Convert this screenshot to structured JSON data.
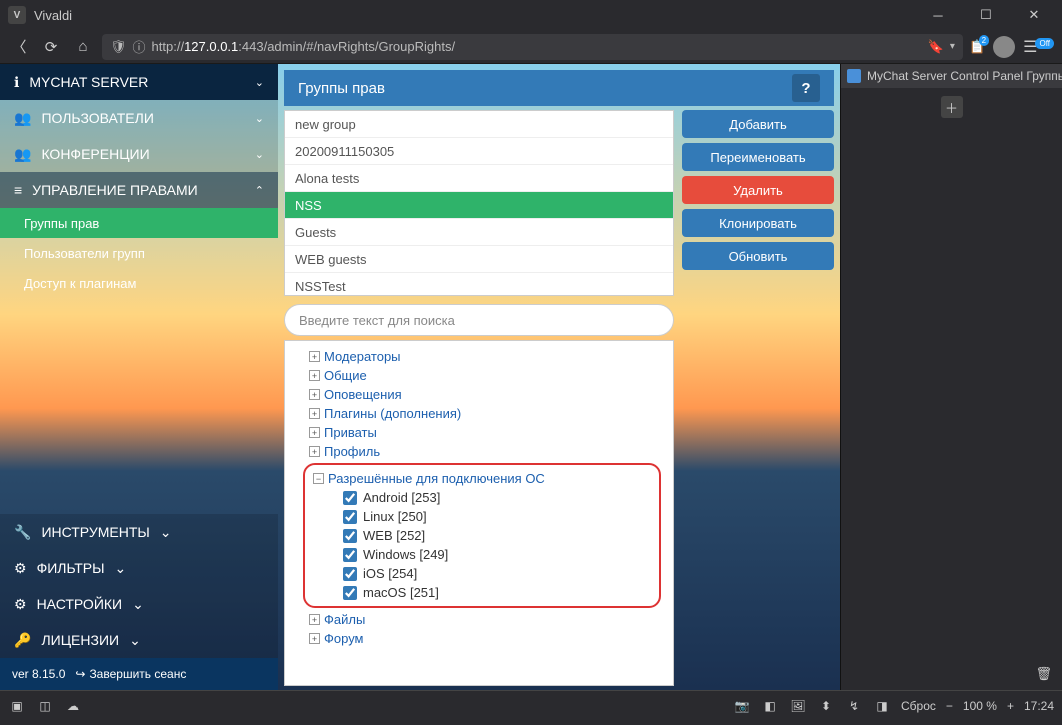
{
  "app": {
    "name": "Vivaldi"
  },
  "address": {
    "scheme": "http://",
    "host": "127.0.0.1",
    "rest": ":443/admin/#/navRights/GroupRights/"
  },
  "sidebar": {
    "items": [
      {
        "label": "MYCHAT SERVER"
      },
      {
        "label": "ПОЛЬЗОВАТЕЛИ"
      },
      {
        "label": "КОНФЕРЕНЦИИ"
      },
      {
        "label": "УПРАВЛЕНИЕ ПРАВАМИ"
      }
    ],
    "submenu": [
      {
        "label": "Группы прав"
      },
      {
        "label": "Пользователи групп"
      },
      {
        "label": "Доступ к плагинам"
      }
    ],
    "bottom": [
      {
        "label": "ИНСТРУМЕНТЫ"
      },
      {
        "label": "ФИЛЬТРЫ"
      },
      {
        "label": "НАСТРОЙКИ"
      },
      {
        "label": "ЛИЦЕНЗИИ"
      }
    ],
    "version": "ver 8.15.0",
    "logout": "Завершить сеанс"
  },
  "page": {
    "title": "Группы прав",
    "help": "?"
  },
  "groups": [
    {
      "name": "new group"
    },
    {
      "name": "20200911150305"
    },
    {
      "name": "Alona tests"
    },
    {
      "name": "NSS"
    },
    {
      "name": "Guests"
    },
    {
      "name": "WEB guests"
    },
    {
      "name": "NSSTest"
    }
  ],
  "search": {
    "placeholder": "Введите текст для поиска"
  },
  "tree": {
    "collapsed": [
      {
        "label": "Модераторы"
      },
      {
        "label": "Общие"
      },
      {
        "label": "Оповещения"
      },
      {
        "label": "Плагины (дополнения)"
      },
      {
        "label": "Приваты"
      },
      {
        "label": "Профиль"
      }
    ],
    "expanded": {
      "label": "Разрешённые для подключения ОС"
    },
    "os_items": [
      {
        "label": "Android [253]"
      },
      {
        "label": "Linux [250]"
      },
      {
        "label": "WEB [252]"
      },
      {
        "label": "Windows [249]"
      },
      {
        "label": "iOS [254]"
      },
      {
        "label": "macOS [251]"
      }
    ],
    "after": [
      {
        "label": "Файлы"
      },
      {
        "label": "Форум"
      }
    ]
  },
  "actions": {
    "add": "Добавить",
    "rename": "Переименовать",
    "delete": "Удалить",
    "clone": "Клонировать",
    "refresh": "Обновить"
  },
  "ext_panel": {
    "title": "MyChat Server Control Panel Группы"
  },
  "statusbar": {
    "reset": "Сброс",
    "zoom": "100 %",
    "time": "17:24",
    "badge": "2",
    "off": "Off"
  }
}
